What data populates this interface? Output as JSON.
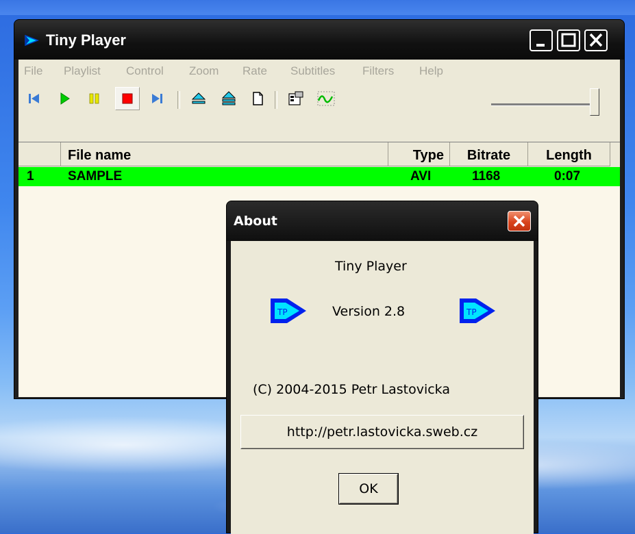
{
  "window": {
    "title": "Tiny Player"
  },
  "menu": [
    "File",
    "Playlist",
    "Control",
    "Zoom",
    "Rate",
    "Subtitles",
    "Filters",
    "Help"
  ],
  "toolbar": {
    "icons": [
      "skip-back-icon",
      "play-icon",
      "pause-icon",
      "stop-icon",
      "skip-forward-icon",
      "eject-icon",
      "eject-all-icon",
      "new-file-icon",
      "properties-icon",
      "waveform-icon"
    ],
    "volume_slider": 0.95
  },
  "playlist": {
    "columns": [
      "",
      "File name",
      "Type",
      "Bitrate",
      "Length"
    ],
    "rows": [
      {
        "index": "1",
        "file_name": "SAMPLE",
        "type": "AVI",
        "bitrate": "1168",
        "length": "0:07"
      }
    ]
  },
  "about": {
    "title": "About",
    "app_name": "Tiny Player",
    "version_label": "Version  2.8",
    "copyright": "(C) 2004-2015  Petr Lastovicka",
    "url_button": "http://petr.lastovicka.sweb.cz",
    "ok_button": "OK"
  },
  "colors": {
    "selected_row": "#00ff00",
    "title_bar": "#111111",
    "client_bg": "#ece9d8",
    "stop_red": "#ff0000",
    "close_red": "#d9441c"
  }
}
